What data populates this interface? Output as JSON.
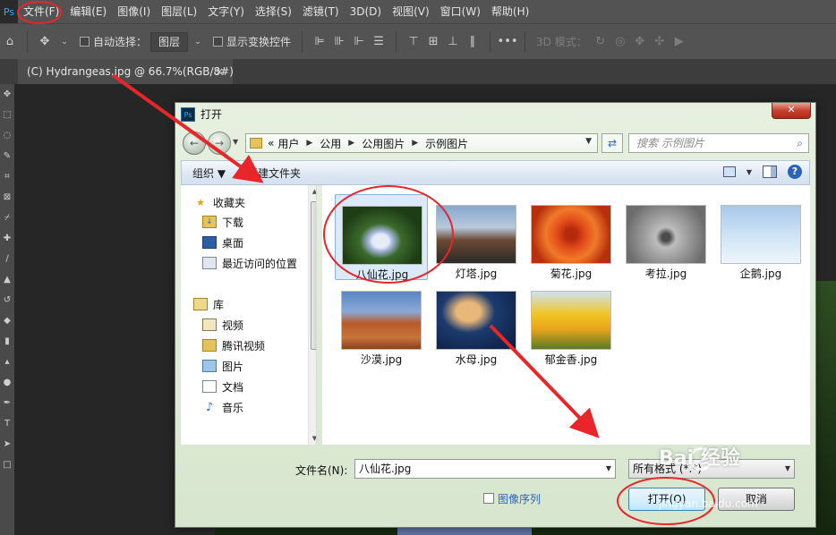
{
  "menubar": {
    "logo": "Ps",
    "items": [
      "文件(F)",
      "编辑(E)",
      "图像(I)",
      "图层(L)",
      "文字(Y)",
      "选择(S)",
      "滤镜(T)",
      "3D(D)",
      "视图(V)",
      "窗口(W)",
      "帮助(H)"
    ]
  },
  "options_bar": {
    "auto_select_label": "自动选择：",
    "auto_select_value": "图层",
    "show_transform_label": "显示变换控件",
    "mode_3d_label": "3D 模式："
  },
  "document_tab": {
    "title": "(C) Hydrangeas.jpg @ 66.7%(RGB/8#)",
    "close_glyph": "×"
  },
  "dialog": {
    "title": "打开",
    "close_glyph": "✕",
    "address": {
      "prefix": "«",
      "crumbs": [
        "用户",
        "公用",
        "公用图片",
        "示例图片"
      ]
    },
    "search_placeholder": "搜索 示例图片",
    "commands": {
      "organize": "组织 ▼",
      "new_folder": "新建文件夹"
    },
    "nav": {
      "favorites_header": "收藏夹",
      "favorites": [
        "下载",
        "桌面",
        "最近访问的位置"
      ],
      "libraries_header": "库",
      "libraries": [
        "视频",
        "腾讯视频",
        "图片",
        "文档",
        "音乐"
      ]
    },
    "files": [
      {
        "name": "八仙花.jpg",
        "thumb": "hydrangea",
        "selected": true
      },
      {
        "name": "灯塔.jpg",
        "thumb": "lighthouse",
        "selected": false
      },
      {
        "name": "菊花.jpg",
        "thumb": "chrysanthemum",
        "selected": false
      },
      {
        "name": "考拉.jpg",
        "thumb": "koala",
        "selected": false
      },
      {
        "name": "企鹅.jpg",
        "thumb": "penguins",
        "selected": false
      },
      {
        "name": "沙漠.jpg",
        "thumb": "desert",
        "selected": false
      },
      {
        "name": "水母.jpg",
        "thumb": "jellyfish",
        "selected": false
      },
      {
        "name": "郁金香.jpg",
        "thumb": "tulips",
        "selected": false
      }
    ],
    "filename_label": "文件名(N):",
    "filename_value": "八仙花.jpg",
    "filetype_value": "所有格式 (*.*)",
    "sequence_label": "图像序列",
    "open_button": "打开(O)",
    "cancel_button": "取消"
  },
  "watermark": {
    "text": "Bai 经验",
    "url": "jingyan.baidu.com"
  },
  "colors": {
    "annotation_red": "#e8262a",
    "ps_panel": "#535353",
    "dialog_bg": "#dce9d6",
    "selection_blue": "#dbeafb"
  }
}
